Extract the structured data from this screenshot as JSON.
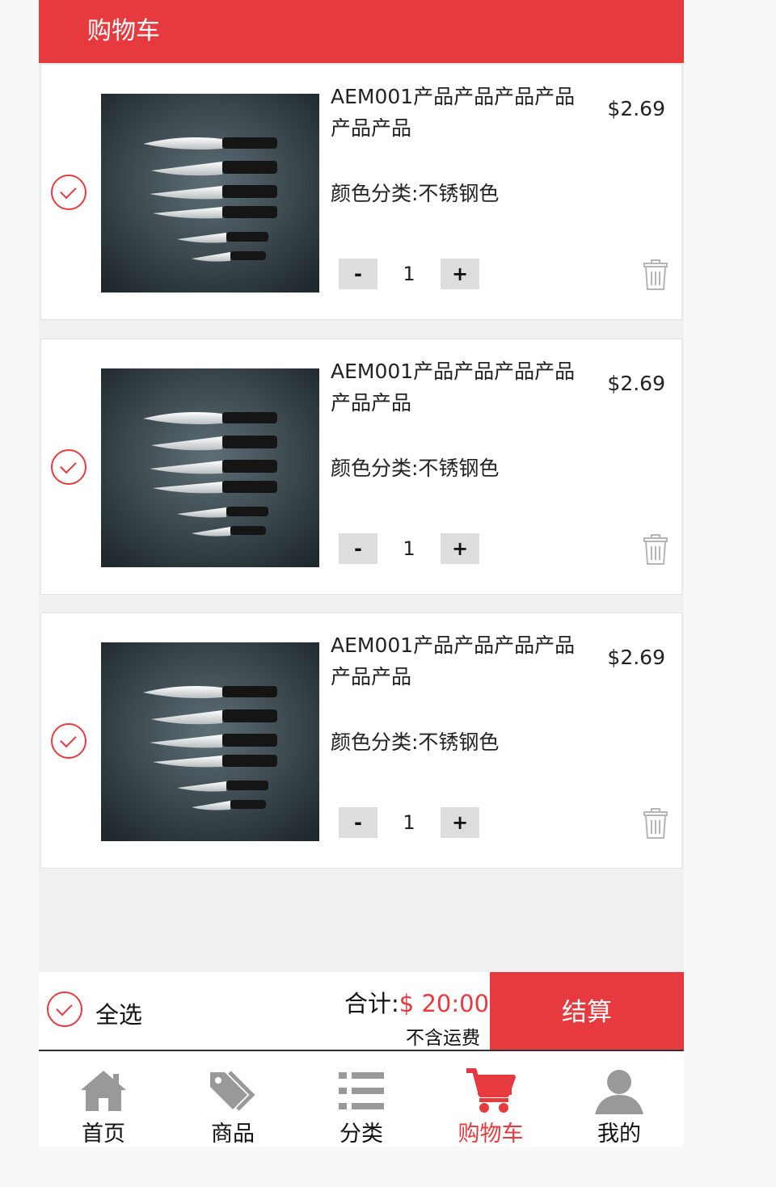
{
  "header": {
    "title": "购物车"
  },
  "cart": {
    "items": [
      {
        "name": "AEM001产品产品产品产品产品产品",
        "price": "$2.69",
        "variant": "颜色分类:不锈钢色",
        "qty": "1"
      },
      {
        "name": "AEM001产品产品产品产品产品产品",
        "price": "$2.69",
        "variant": "颜色分类:不锈钢色",
        "qty": "1"
      },
      {
        "name": "AEM001产品产品产品产品产品产品",
        "price": "$2.69",
        "variant": "颜色分类:不锈钢色",
        "qty": "1"
      }
    ],
    "qty_minus": "-",
    "qty_plus": "+"
  },
  "footer": {
    "select_all": "全选",
    "total_label": "合计:",
    "total_value": "$ 20:00",
    "shipping_note": "不含运费",
    "checkout": "结算"
  },
  "tabs": [
    {
      "label": "首页",
      "icon": "home-icon"
    },
    {
      "label": "商品",
      "icon": "tag-icon"
    },
    {
      "label": "分类",
      "icon": "list-icon"
    },
    {
      "label": "购物车",
      "icon": "cart-icon",
      "active": true
    },
    {
      "label": "我的",
      "icon": "user-icon"
    }
  ],
  "colors": {
    "accent": "#e63a3e",
    "background": "#f0f0f0",
    "inactive_icon": "#999999"
  }
}
